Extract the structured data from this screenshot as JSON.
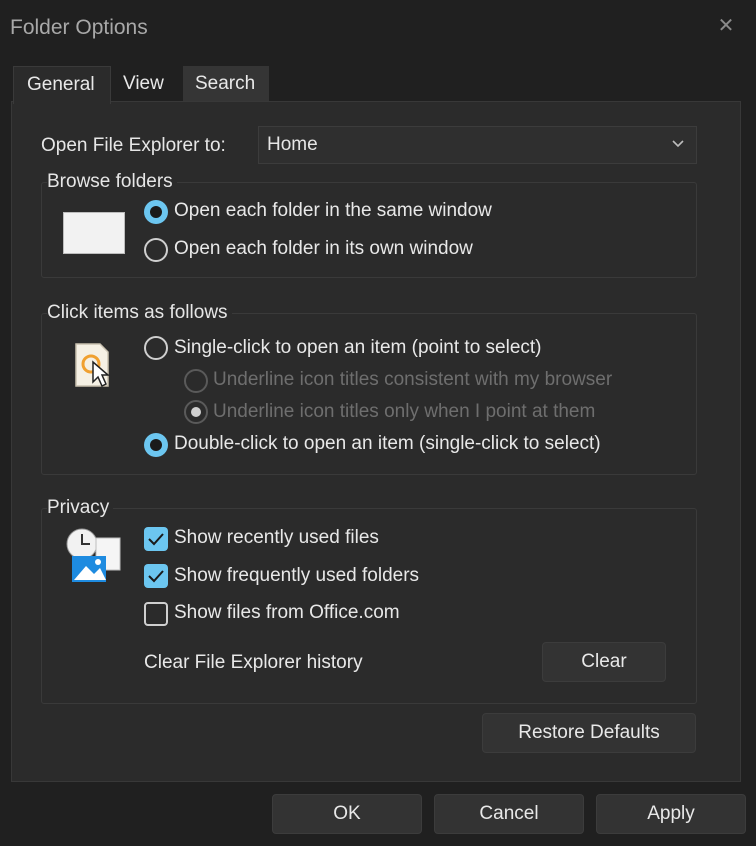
{
  "window": {
    "title": "Folder Options",
    "close_glyph": "✕"
  },
  "tabs": [
    {
      "label": "General",
      "selected": true
    },
    {
      "label": "View",
      "selected": false
    },
    {
      "label": "Search",
      "selected": false
    }
  ],
  "open_explorer": {
    "label": "Open File Explorer to:",
    "value": "Home"
  },
  "browse": {
    "title": "Browse folders",
    "options": [
      {
        "label": "Open each folder in the same window",
        "checked": true
      },
      {
        "label": "Open each folder in its own window",
        "checked": false
      }
    ]
  },
  "click": {
    "title": "Click items as follows",
    "options": [
      {
        "label": "Single-click to open an item (point to select)",
        "checked": false
      },
      {
        "label": "Underline icon titles consistent with my browser",
        "checked": false,
        "disabled": true
      },
      {
        "label": "Underline icon titles only when I point at them",
        "checked": true,
        "disabled": true
      },
      {
        "label": "Double-click to open an item (single-click to select)",
        "checked": true
      }
    ]
  },
  "privacy": {
    "title": "Privacy",
    "options": [
      {
        "label": "Show recently used files",
        "checked": true
      },
      {
        "label": "Show frequently used folders",
        "checked": true
      },
      {
        "label": "Show files from Office.com",
        "checked": false
      }
    ],
    "clear_label": "Clear File Explorer history",
    "clear_button": "Clear"
  },
  "restore_button": "Restore Defaults",
  "footer": {
    "ok": "OK",
    "cancel": "Cancel",
    "apply": "Apply"
  },
  "colors": {
    "accent": "#6cc6f0",
    "background": "#202020",
    "panel": "#2b2b2b"
  }
}
